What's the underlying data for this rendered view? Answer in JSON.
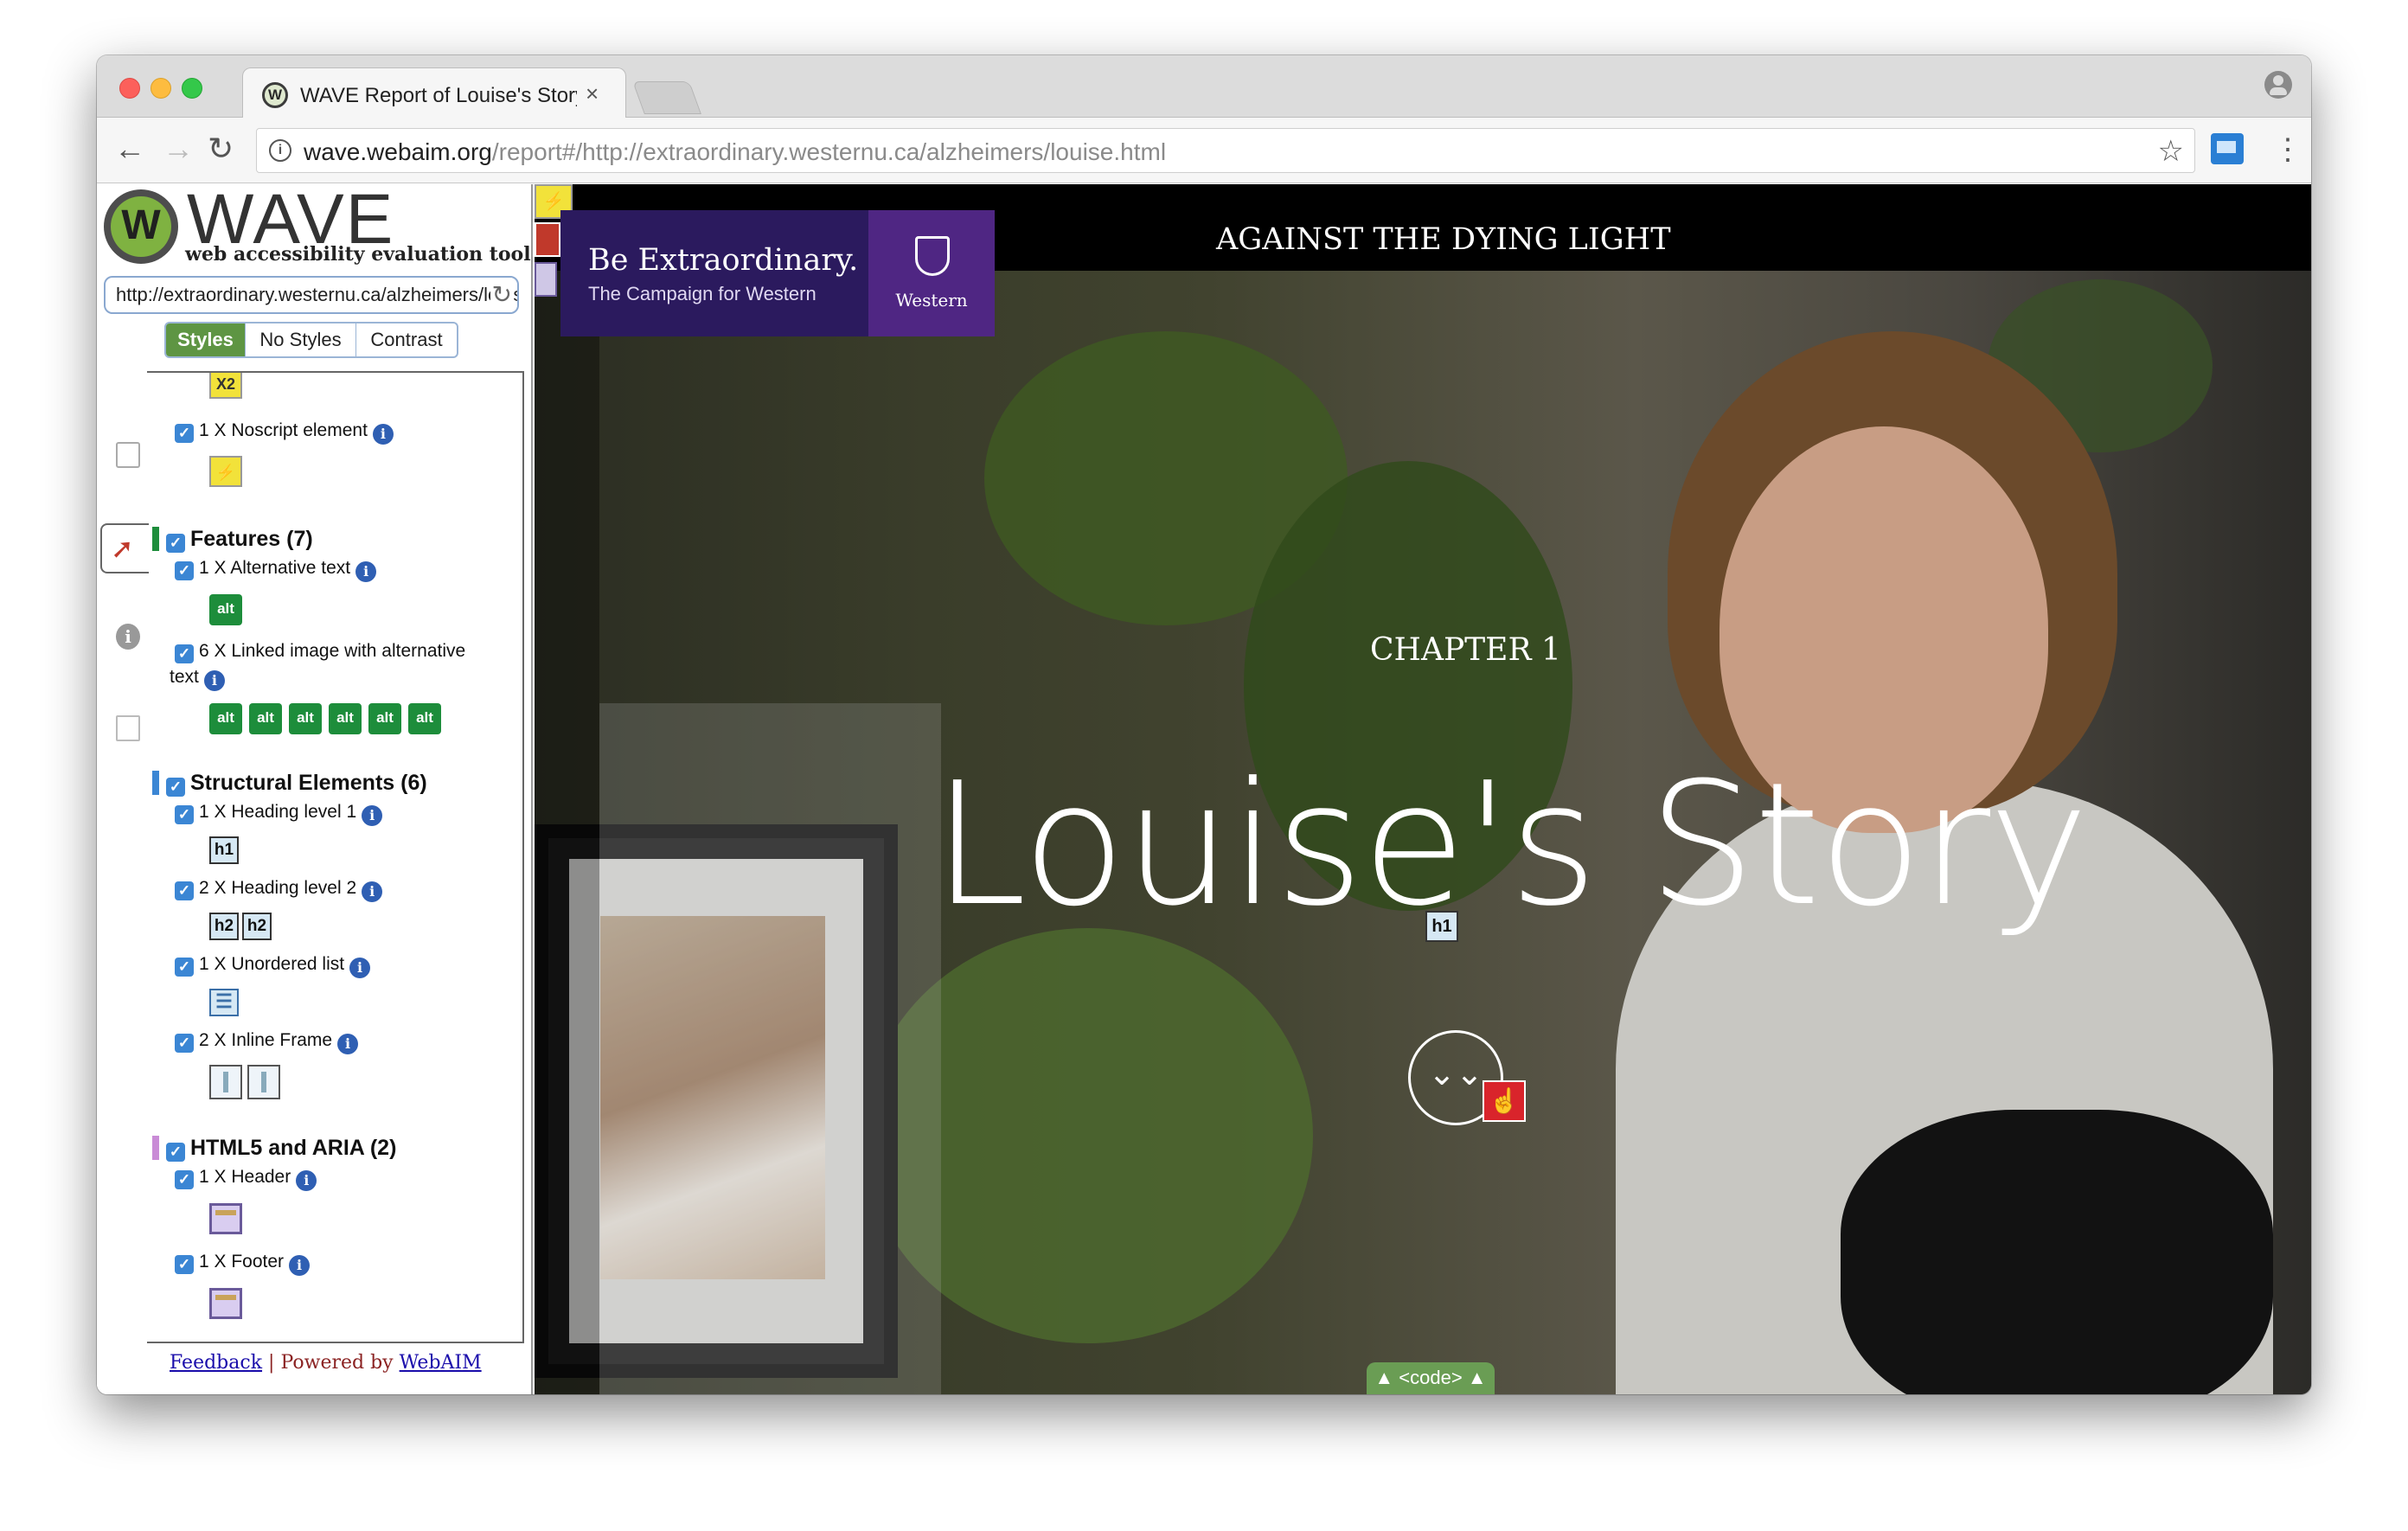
{
  "browser": {
    "tab_title": "WAVE Report of Louise's Story",
    "tab_favicon_letter": "W",
    "close_glyph": "×",
    "url_host": "wave.webaim.org",
    "url_rest": "/report#/http://extraordinary.westernu.ca/alzheimers/louise.html",
    "back_glyph": "←",
    "forward_glyph": "→",
    "reload_glyph": "↻",
    "info_glyph": "i",
    "star_glyph": "☆",
    "menu_glyph": "⋮"
  },
  "wave": {
    "logo_letter": "W",
    "title": "WAVE",
    "subtitle": "web accessibility evaluation tool",
    "url_value": "http://extraordinary.westernu.ca/alzheimers/louise.html",
    "refresh_glyph": "↻",
    "view_tabs": [
      "Styles",
      "No Styles",
      "Contrast"
    ],
    "side_info_glyph": "i",
    "flag_glyph": "➚",
    "x2_label": "X2",
    "noscript": {
      "label": "1 X Noscript element",
      "glyph": "⚡"
    },
    "features": {
      "title": "Features (7)",
      "color": "#1d8d3b",
      "items": [
        {
          "label": "1 X Alternative text",
          "icon_text": "alt"
        },
        {
          "label": "6 X Linked image with alternative",
          "label_cont": "text",
          "icon_text": "alt"
        }
      ]
    },
    "structural": {
      "title": "Structural Elements (6)",
      "color": "#3b86d4",
      "items": [
        {
          "label": "1 X Heading level 1",
          "icons": [
            "h1"
          ]
        },
        {
          "label": "2 X Heading level 2",
          "icons": [
            "h2",
            "h2"
          ]
        },
        {
          "label": "1 X Unordered list",
          "icon_glyph": "☰"
        },
        {
          "label": "2 X Inline Frame"
        }
      ]
    },
    "html5": {
      "title": "HTML5 and ARIA (2)",
      "color": "#c98bd6",
      "items": [
        {
          "label": "1 X Header"
        },
        {
          "label": "1 X Footer"
        }
      ]
    },
    "check_glyph": "✓",
    "info_glyph": "i",
    "footer": {
      "feedback": "Feedback",
      "separator": "|",
      "powered_by": "Powered by",
      "webaim": "WebAIM"
    }
  },
  "page": {
    "header_title": "AGAINST THE DYING LIGHT",
    "brand_main": "Be Extraordinary.",
    "brand_sub": "The Campaign for Western",
    "brand_name": "Western",
    "chapter": "CHAPTER 1",
    "title": "Louise's Story",
    "h1_badge": "h1",
    "scroll_glyph": "⌄⌄",
    "link_glyph": "☝",
    "code_tab": "▲ <code> ▲"
  }
}
